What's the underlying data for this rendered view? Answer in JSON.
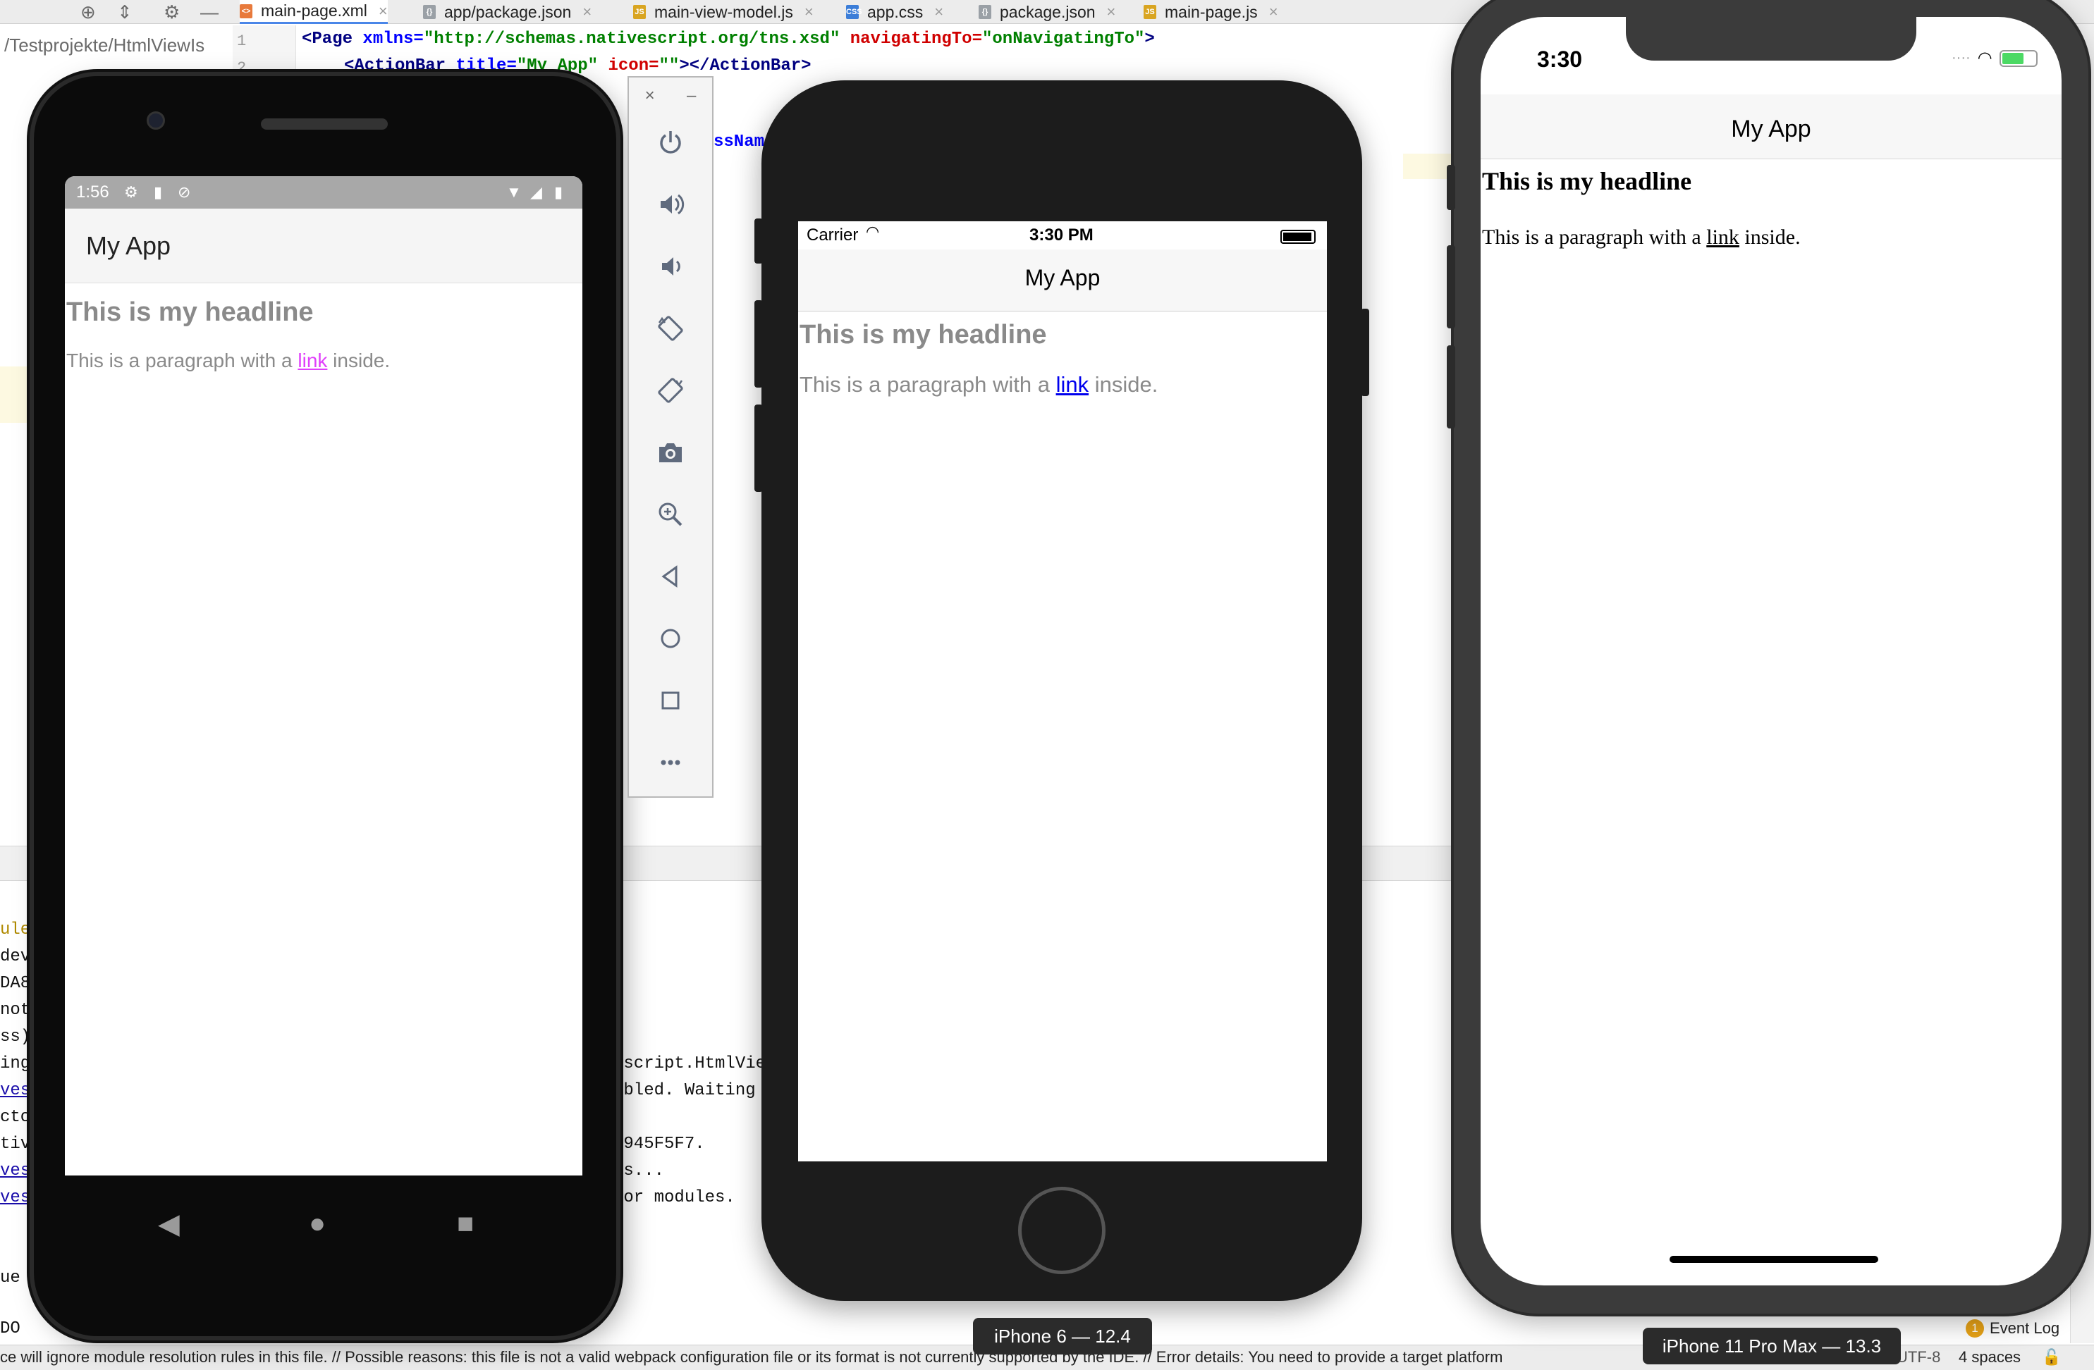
{
  "ide": {
    "tabs": [
      {
        "label": "main-page.xml",
        "kind": "xml"
      },
      {
        "label": "app/package.json",
        "kind": "json"
      },
      {
        "label": "main-view-model.js",
        "kind": "js"
      },
      {
        "label": "app.css",
        "kind": "css"
      },
      {
        "label": "package.json",
        "kind": "json"
      },
      {
        "label": "main-page.js",
        "kind": "js"
      }
    ],
    "project_path": "/Testprojekte/HtmlViewIs",
    "line_numbers": [
      "1",
      "2"
    ],
    "code_line_1": {
      "open": "<Page ",
      "attr1": "xmlns=",
      "val1": "\"http://schemas.nativescript.org/tns.xsd\"",
      "attr2": " navigatingTo=",
      "val2": "\"onNavigatingTo\"",
      "close": ">"
    },
    "code_line_2": {
      "open": "<ActionBar ",
      "attr1": "title=",
      "val1": "\"My App\"",
      "attr2": " icon=",
      "val2": "\"\"",
      "close": "></ActionBar>"
    },
    "code_fragment": "ssName",
    "console_left": [
      "ules",
      "devi",
      "DA8—",
      "not",
      "ss)[",
      "ingb",
      "vesc",
      "ctor",
      "tive",
      "vesc",
      "vesc",
      "ue %",
      "DO"
    ],
    "console_right": [
      "escript.HtmlVie",
      "abled. Waiting",
      "3945F5F7.",
      "es...",
      "tor modules."
    ],
    "status_message": "ce will ignore module resolution rules in this file. // Possible reasons: this file is not a valid webpack configuration file or its format is not currently supported by the IDE. // Error details:  You need to provide a target platform",
    "encoding": "UTF-8",
    "indent": "4 spaces",
    "event_log": {
      "label": "Event Log",
      "count": "1"
    }
  },
  "android": {
    "status_time": "1:56",
    "app_title": "My App",
    "headline": "This is my headline",
    "para_before": "This is a paragraph with a ",
    "link": "link",
    "para_after": " inside."
  },
  "emulator_panel": {
    "close": "×",
    "minimize": "–",
    "buttons": [
      "power-icon",
      "volume-up-icon",
      "volume-down-icon",
      "rotate-left-icon",
      "rotate-right-icon",
      "camera-icon",
      "zoom-icon",
      "back-icon",
      "home-icon",
      "overview-icon",
      "more-icon"
    ]
  },
  "iphone6": {
    "carrier": "Carrier",
    "time": "3:30 PM",
    "app_title": "My App",
    "headline": "This is my headline",
    "para_before": "This is a paragraph with a ",
    "link": "link",
    "para_after": " inside.",
    "device_label": "iPhone 6 — 12.4"
  },
  "iphone11": {
    "time": "3:30",
    "app_title": "My App",
    "headline": "This is my headline",
    "para_before": "This is a paragraph with a ",
    "link": "link",
    "para_after": " inside.",
    "device_label": "iPhone 11 Pro Max — 13.3"
  }
}
